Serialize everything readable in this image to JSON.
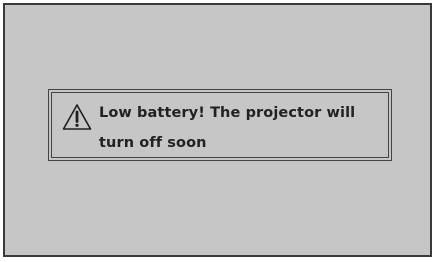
{
  "dialog": {
    "icon": "warning-triangle-icon",
    "message": "Low battery! The projector will turn off soon"
  },
  "colors": {
    "screen_background": "#c6c6c6",
    "border": "#3a3a3a",
    "text": "#222222"
  }
}
